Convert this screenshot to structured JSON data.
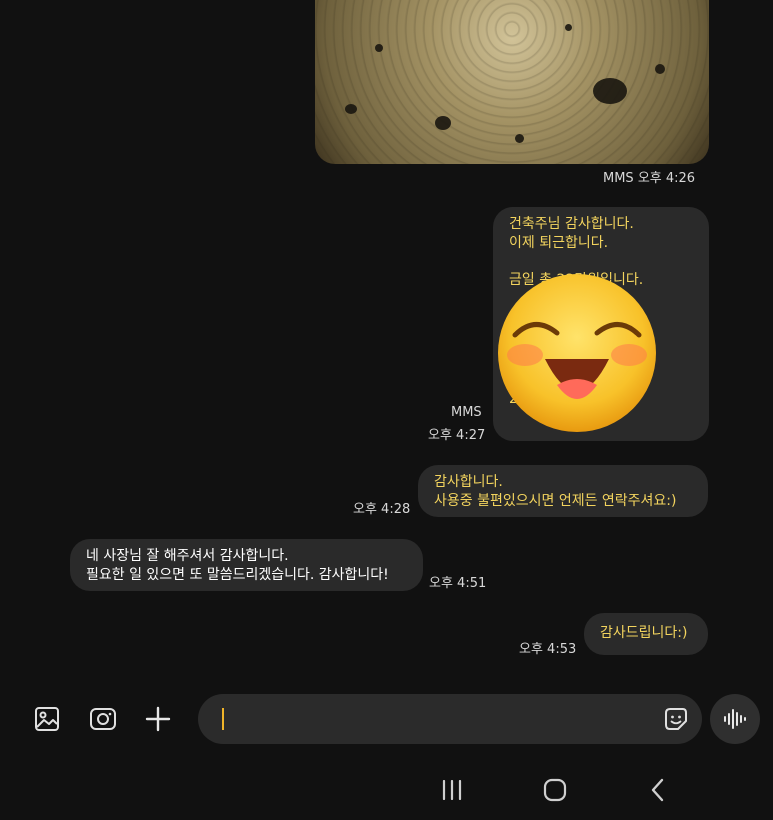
{
  "messages": [
    {
      "id": "photo",
      "meta": "MMS 오후 4:26"
    },
    {
      "id": "invoice",
      "lines": [
        "건축주님 감사합니다.",
        "이제 퇴근합니다.",
        "",
        "금일 총 22만원입니다.",
        "",
        "",
        "",
        "22만원"
      ],
      "meta_type": "MMS",
      "meta_time": "오후 4:27"
    },
    {
      "id": "thanks",
      "lines": [
        "감사합니다.",
        "사용중 불편있으시면 언제든 연락주셔요:)"
      ],
      "meta_time": "오후 4:28"
    },
    {
      "id": "reply",
      "lines": [
        "네 사장님 잘 해주셔서 감사합니다.",
        "필요한 일 있으면 또 말씀드리겠습니다. 감사합니다!"
      ],
      "meta_time": "오후 4:51"
    },
    {
      "id": "final",
      "lines": [
        "감사드립니다:)"
      ],
      "meta_time": "오후 4:53"
    }
  ],
  "input": {
    "value": "",
    "placeholder": ""
  },
  "icons": {
    "gallery": "gallery-icon",
    "camera": "camera-icon",
    "add": "plus-icon",
    "sticker": "emoji-sticker-icon",
    "voice": "voice-record-icon",
    "nav_recents": "recents-icon",
    "nav_home": "home-icon",
    "nav_back": "back-icon"
  },
  "colors": {
    "background": "#111111",
    "bubble": "#2a2a2a",
    "sent_text": "#f3d45e",
    "received_text": "#ffffff",
    "cursor": "#f0b429"
  }
}
